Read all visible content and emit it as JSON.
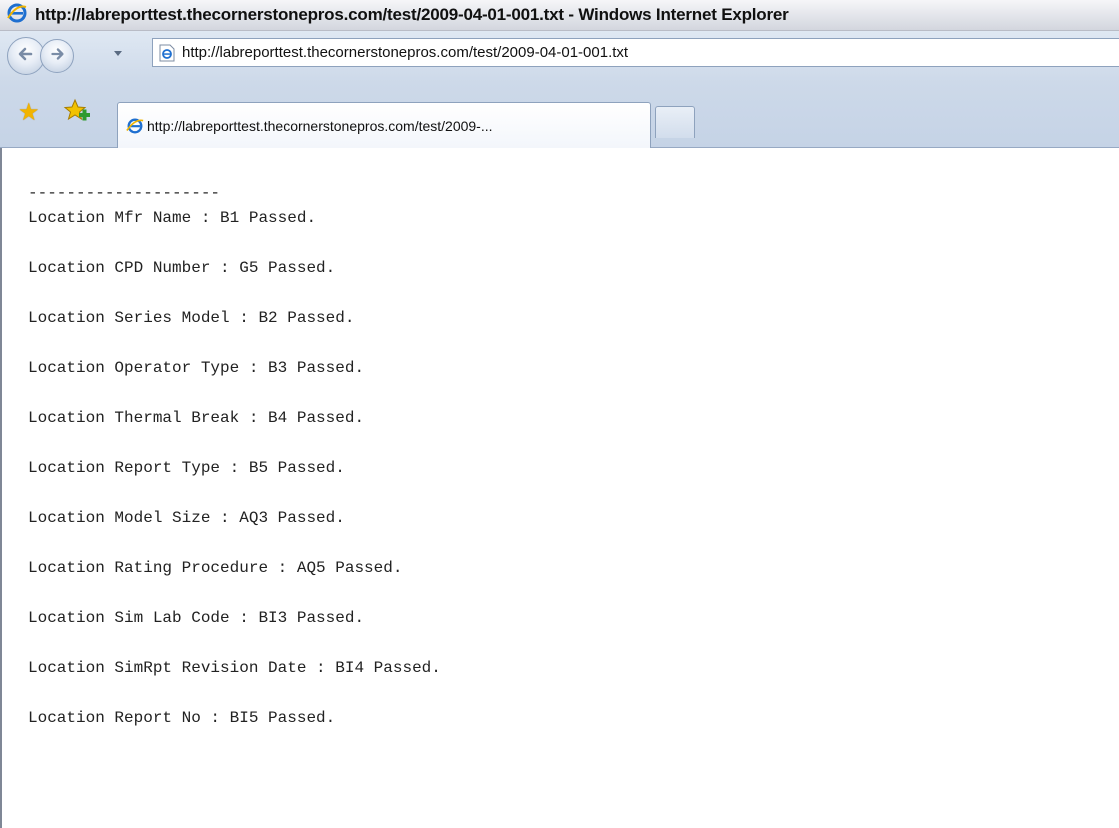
{
  "window": {
    "title": "http://labreporttest.thecornerstonepros.com/test/2009-04-01-001.txt - Windows Internet Explorer"
  },
  "address_bar": {
    "url": "http://labreporttest.thecornerstonepros.com/test/2009-04-01-001.txt"
  },
  "tabs": [
    {
      "label": "http://labreporttest.thecornerstonepros.com/test/2009-...",
      "active": true
    }
  ],
  "icons": {
    "title": "ie-logo-icon",
    "back": "back-arrow-icon",
    "forward": "forward-arrow-icon",
    "favorites": "star-icon",
    "add_favorites": "add-favorites-icon",
    "page": "ie-page-icon"
  },
  "colors": {
    "titlebar": "#e2e4ea",
    "toolbar": "#cdd9e9",
    "content_bg": "#ffffff",
    "text": "#222222"
  },
  "document": {
    "text": "--------------------\nLocation Mfr Name : B1 Passed.\n\nLocation CPD Number : G5 Passed.\n\nLocation Series Model : B2 Passed.\n\nLocation Operator Type : B3 Passed.\n\nLocation Thermal Break : B4 Passed.\n\nLocation Report Type : B5 Passed.\n\nLocation Model Size : AQ3 Passed.\n\nLocation Rating Procedure : AQ5 Passed.\n\nLocation Sim Lab Code : BI3 Passed.\n\nLocation SimRpt Revision Date : BI4 Passed.\n\nLocation Report No : BI5 Passed."
  }
}
